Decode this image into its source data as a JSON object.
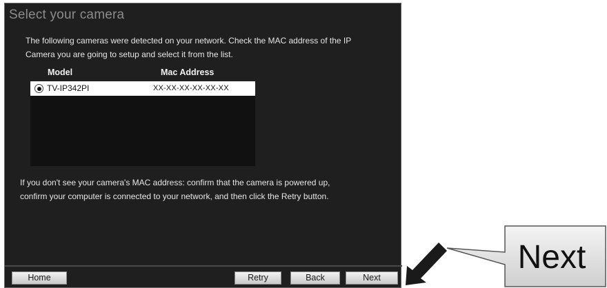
{
  "dialog": {
    "title": "Select your camera",
    "intro_line1": "The following cameras were detected on your network. Check the MAC address of the IP",
    "intro_line2": "Camera you are going to setup and select it from the list.",
    "table": {
      "columns": [
        "Model",
        "Mac Address"
      ],
      "rows": [
        {
          "model": "TV-IP342PI",
          "mac": "XX-XX-XX-XX-XX-XX",
          "selected": true
        }
      ]
    },
    "note_line1": "If you don't see your camera's MAC address: confirm that the camera is powered up,",
    "note_line2": "confirm your computer is connected to your network, and then click the Retry button."
  },
  "footer": {
    "home_label": "Home",
    "retry_label": "Retry",
    "back_label": "Back",
    "next_label": "Next"
  },
  "callout": {
    "label": "Next"
  },
  "colors": {
    "window_bg": "#1f1f1f",
    "title_text": "#8c8c8c",
    "body_text": "#e6e6e6",
    "list_bg": "#111111",
    "selected_row_bg": "#ffffff"
  },
  "icons": {
    "radio": "radio-selected-icon",
    "pointer": "pointer-arrow-icon"
  }
}
